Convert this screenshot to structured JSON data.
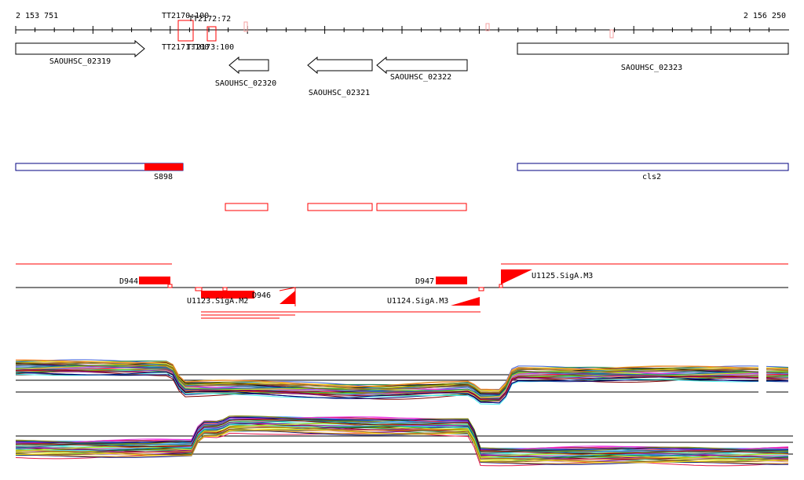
{
  "colors": {
    "feature_red": "#ff0000",
    "outline": "#000000",
    "operon_blue": "#000080",
    "tick_pink": "#f4a0a0",
    "background": "#ffffff"
  },
  "ruler": {
    "start_label": "2 153 751",
    "end_label": "2 156 250"
  },
  "terminators": {
    "labels": [
      "TT2170:100",
      "TT2172:72",
      "TT2171:100",
      "TT2173:100"
    ]
  },
  "genes": [
    {
      "label": "SAOUHSC_02319",
      "strand": "forward"
    },
    {
      "label": "SAOUHSC_02320",
      "strand": "reverse"
    },
    {
      "label": "SAOUHSC_02321",
      "strand": "reverse"
    },
    {
      "label": "SAOUHSC_02322",
      "strand": "reverse"
    },
    {
      "label": "SAOUHSC_02323",
      "strand": "forward"
    }
  ],
  "operons": [
    {
      "label": "S898"
    },
    {
      "label": "cls2"
    }
  ],
  "transcripts": {
    "labels": [
      "D944",
      "D946",
      "D947",
      "U1125.SigA.M3",
      "U1124.SigA.M3",
      "U1123.SigA.M2"
    ]
  },
  "expression_tracks": [
    {
      "name": "expression-top"
    },
    {
      "name": "expression-bottom"
    }
  ]
}
